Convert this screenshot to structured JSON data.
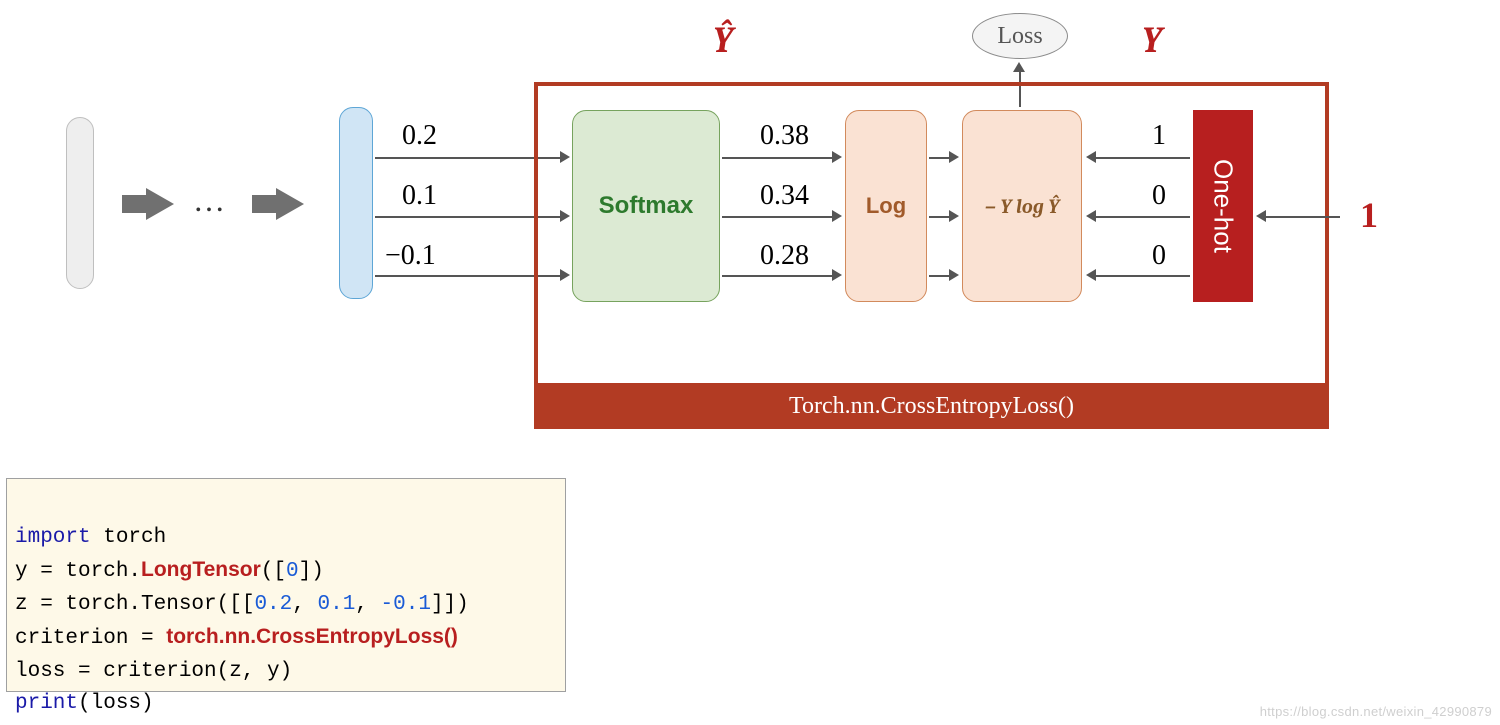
{
  "labels": {
    "yhat": "Ŷ",
    "y": "Y",
    "softmax": "Softmax",
    "log": "Log",
    "nllog": "− Y log Ŷ",
    "onehot": "One-hot",
    "one": "1",
    "loss": "Loss",
    "caption": "Torch.nn.CrossEntropyLoss()"
  },
  "logits": [
    "0.2",
    "0.1",
    "−0.1"
  ],
  "probs": [
    "0.38",
    "0.34",
    "0.28"
  ],
  "onehot_vec": [
    "1",
    "0",
    "0"
  ],
  "dots": "…",
  "code": {
    "l1_kw": "import",
    "l1_rest": " torch",
    "l2_pre": "y = torch.",
    "l2_bold": "LongTensor",
    "l2_post": "([",
    "l2_num": "0",
    "l2_end": "])",
    "l3_pre": "z = torch.Tensor([[",
    "l3_n1": "0.2",
    "l3_c1": ", ",
    "l3_n2": "0.1",
    "l3_c2": ", ",
    "l3_n3": "-0.1",
    "l3_end": "]])",
    "l4_pre": "criterion = ",
    "l4_bold": "torch.nn.CrossEntropyLoss()",
    "l5": "loss = criterion(z, y)",
    "l6_kw": "print",
    "l6_rest": "(loss)"
  },
  "watermark": "https://blog.csdn.net/weixin_42990879"
}
